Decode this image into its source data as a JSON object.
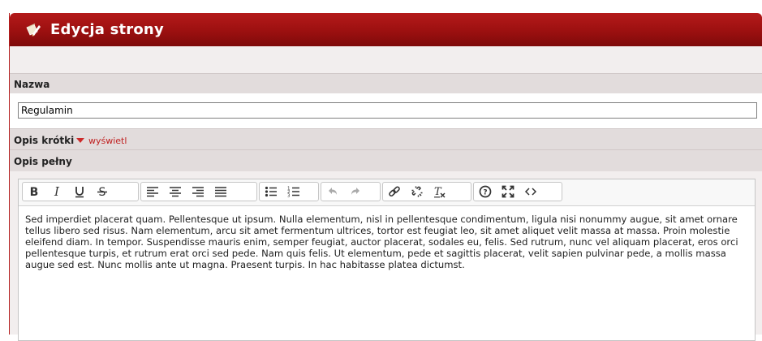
{
  "header": {
    "title": "Edycja strony",
    "icon": "edit-page-icon"
  },
  "fields": {
    "name_label": "Nazwa",
    "name_value": "Regulamin",
    "short_desc_label": "Opis krótki",
    "short_desc_toggle": "wyświetl",
    "full_desc_label": "Opis pełny"
  },
  "toolbar": {
    "groups": [
      [
        "bold-icon",
        "italic-icon",
        "underline-icon",
        "strikethrough-icon"
      ],
      [
        "align-left-icon",
        "align-center-icon",
        "align-right-icon",
        "align-justify-icon"
      ],
      [
        "bullet-list-icon",
        "numbered-list-icon"
      ],
      [
        "undo-icon",
        "redo-icon"
      ],
      [
        "link-icon",
        "unlink-icon",
        "clear-format-icon"
      ],
      [
        "help-icon",
        "fullscreen-icon",
        "source-code-icon"
      ]
    ]
  },
  "editor": {
    "content": "Sed imperdiet placerat quam. Pellentesque ut ipsum. Nulla elementum, nisl in pellentesque condimentum, ligula nisi nonummy augue, sit amet ornare tellus libero sed risus. Nam elementum, arcu sit amet fermentum ultrices, tortor est feugiat leo, sit amet aliquet velit massa at massa. Proin molestie eleifend diam. In tempor. Suspendisse mauris enim, semper feugiat, auctor placerat, sodales eu, felis. Sed rutrum, nunc vel aliquam placerat, eros orci pellentesque turpis, et rutrum erat orci sed pede. Nam quis felis. Ut elementum, pede et sagittis placerat, velit sapien pulvinar pede, a mollis massa augue sed est. Nunc mollis ante ut magna. Praesent turpis. In hac habitasse platea dictumst."
  },
  "colors": {
    "header": "#9c1010",
    "toggle_link": "#c02020",
    "row_bg": "#e2dcdc"
  }
}
